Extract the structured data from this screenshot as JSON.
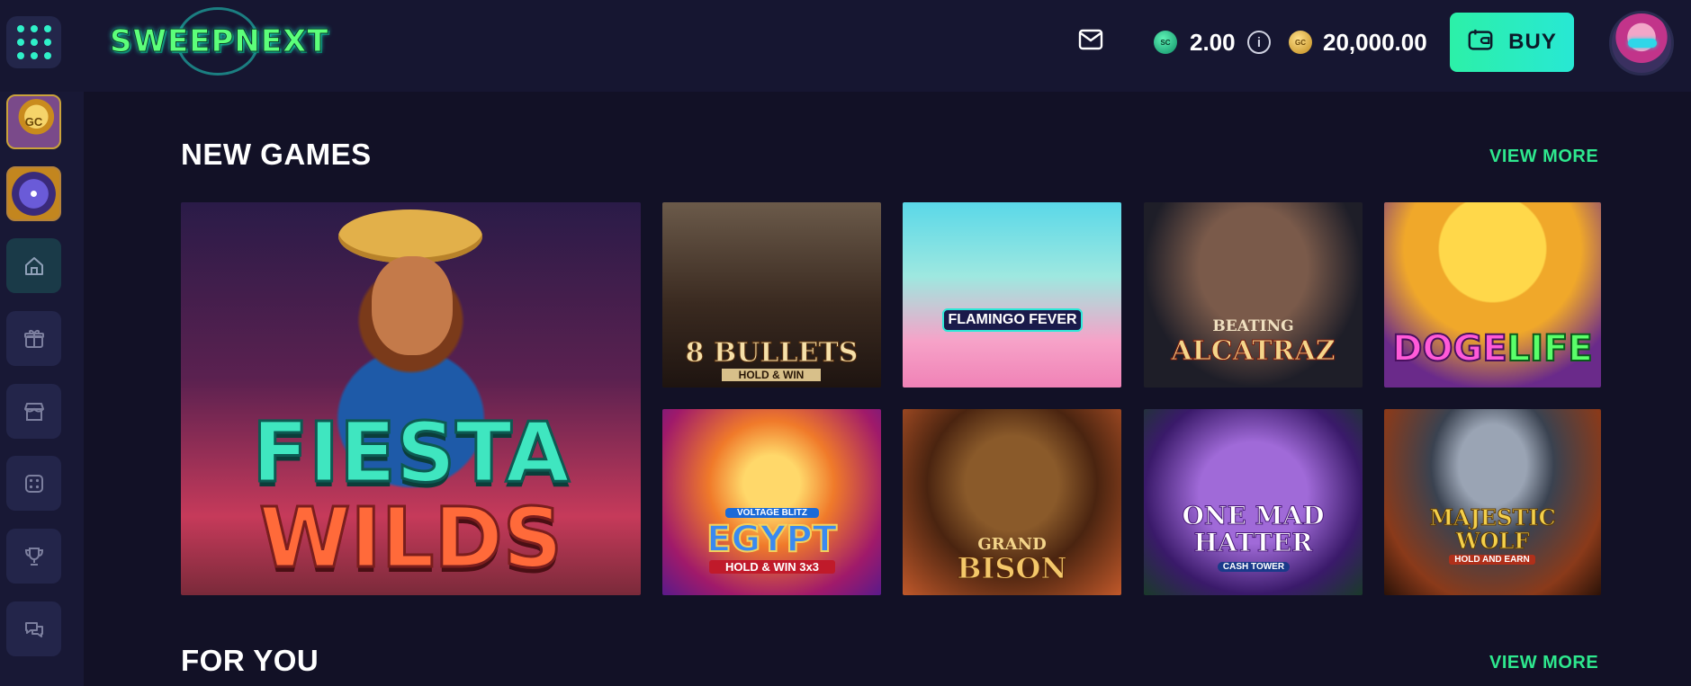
{
  "header": {
    "logo_text": "SWEEPNEXT",
    "sc_coin_label": "SC",
    "sc_balance": "2.00",
    "info_glyph": "i",
    "gc_coin_label": "GC",
    "gc_balance": "20,000.00",
    "buy_label": "BUY",
    "icons": {
      "menu": "grid-dots-icon",
      "mail": "mail-icon",
      "info": "info-icon",
      "buy": "wallet-icon",
      "avatar": "user-avatar"
    }
  },
  "sidebar": {
    "items": [
      {
        "icon": "gc-coin-promo-icon",
        "promo_label": "GC"
      },
      {
        "icon": "prize-wheel-icon"
      },
      {
        "icon": "home-icon",
        "active": true
      },
      {
        "icon": "gift-icon"
      },
      {
        "icon": "store-icon"
      },
      {
        "icon": "dice-icon"
      },
      {
        "icon": "trophy-icon"
      },
      {
        "icon": "chat-icon"
      }
    ]
  },
  "sections": [
    {
      "title": "NEW GAMES",
      "view_more": "VIEW MORE",
      "games": [
        {
          "title_line1": "FIESTA",
          "title_line2": "WILDS"
        },
        {
          "title_line1": "8 BULLETS",
          "subtitle": "HOLD & WIN"
        },
        {
          "title_line1": "FLAMINGO FEVER"
        },
        {
          "title_line1": "BEATING",
          "title_line2": "ALCATRAZ"
        },
        {
          "title_line1": "DOGE",
          "title_line2": "LIFE"
        },
        {
          "pretitle": "VOLTAGE BLITZ",
          "title_line1": "EGYPT",
          "subtitle": "HOLD & WIN 3x3"
        },
        {
          "title_line1": "GRAND",
          "title_line2": "BISON"
        },
        {
          "title_line1": "ONE MAD",
          "title_line2": "HATTER",
          "subtitle": "CASH TOWER"
        },
        {
          "title_line1": "MAJESTIC",
          "title_line2": "WOLF",
          "subtitle": "HOLD AND EARN"
        }
      ]
    },
    {
      "title": "FOR YOU",
      "view_more": "VIEW MORE"
    }
  ],
  "colors": {
    "page_bg": "#121126",
    "header_bg": "#161631",
    "accent_green": "#2ee88e",
    "buy_gradient_start": "#2cf0a8",
    "buy_gradient_end": "#28e8d4"
  }
}
